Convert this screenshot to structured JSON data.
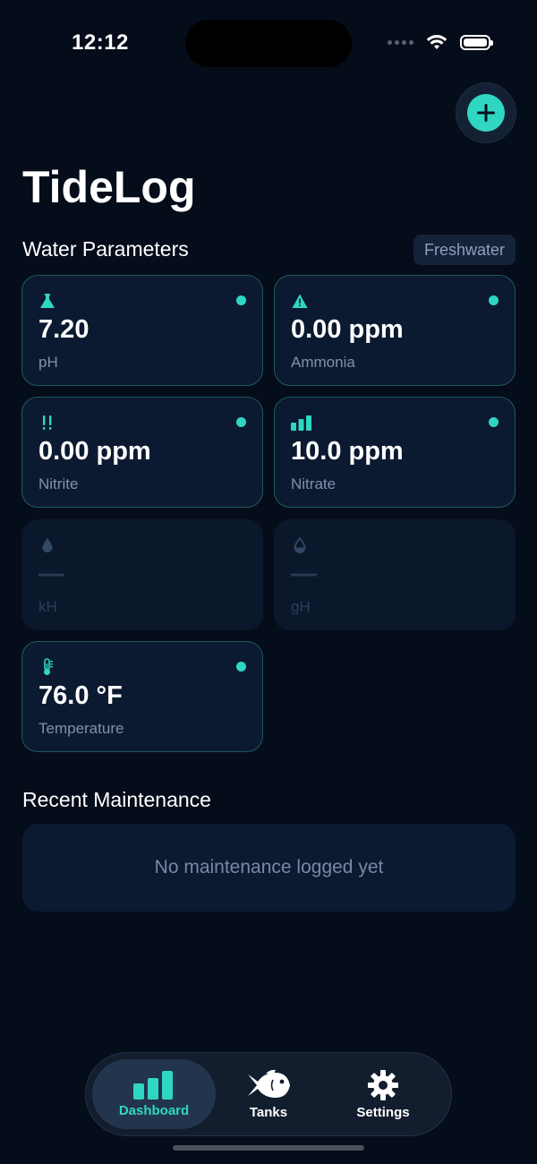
{
  "status": {
    "time": "12:12"
  },
  "app": {
    "title": "TideLog"
  },
  "water_parameters": {
    "title": "Water Parameters",
    "badge": "Freshwater",
    "cards": [
      {
        "icon": "flask-icon",
        "value": "7.20",
        "label": "pH",
        "active": true
      },
      {
        "icon": "warning-icon",
        "value": "0.00 ppm",
        "label": "Ammonia",
        "active": true
      },
      {
        "icon": "exclamation-icon",
        "value": "0.00 ppm",
        "label": "Nitrite",
        "active": true
      },
      {
        "icon": "bar-chart-icon",
        "value": "10.0 ppm",
        "label": "Nitrate",
        "active": true
      },
      {
        "icon": "drop-icon",
        "value": "—",
        "label": "kH",
        "active": false
      },
      {
        "icon": "drop-half-icon",
        "value": "—",
        "label": "gH",
        "active": false
      },
      {
        "icon": "thermometer-icon",
        "value": "76.0 °F",
        "label": "Temperature",
        "active": true
      }
    ]
  },
  "maintenance": {
    "title": "Recent Maintenance",
    "empty_text": "No maintenance logged yet"
  },
  "tabs": [
    {
      "label": "Dashboard",
      "icon": "chart-icon",
      "active": true
    },
    {
      "label": "Tanks",
      "icon": "fish-icon",
      "active": false
    },
    {
      "label": "Settings",
      "icon": "gear-icon",
      "active": false
    }
  ],
  "colors": {
    "accent": "#2fd7c2",
    "background": "#050c1a",
    "card": "#0b1a30"
  }
}
